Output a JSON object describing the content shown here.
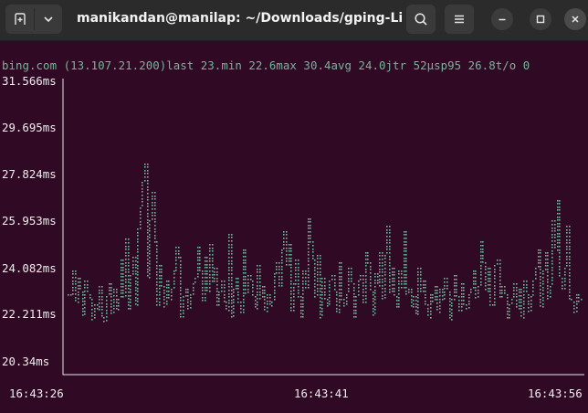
{
  "window": {
    "title": "manikandan@manilap: ~/Downloads/gping-Lin..."
  },
  "icons": {
    "new_tab": "new-tab-icon",
    "menu_dropdown": "chevron-down-icon",
    "search": "search-icon",
    "menu": "hamburger-icon",
    "minimize": "minimize-icon",
    "maximize": "maximize-icon",
    "close": "close-icon"
  },
  "colors": {
    "terminal_bg": "#300a24",
    "plot_line": "#74b49a",
    "text": "#ededed"
  },
  "status_line": "bing.com (13.107.21.200)last 23.min 22.6max 30.4avg 24.0jtr 52μsp95 26.8t/o 0",
  "chart_data": {
    "type": "line",
    "title": "",
    "xlabel": "",
    "ylabel": "",
    "ylim": [
      20.34,
      31.566
    ],
    "y_ticks": [
      "31.566ms",
      "29.695ms",
      "27.824ms",
      "25.953ms",
      "24.082ms",
      "22.211ms",
      "20.34ms"
    ],
    "x_ticks": [
      "16:43:26",
      "16:43:41",
      "16:43:56"
    ],
    "xlim": [
      "16:43:26",
      "16:43:56"
    ],
    "grid": false,
    "legend": "none",
    "series": [
      {
        "host": "bing.com",
        "values": [
          23.4,
          23.3,
          24.3,
          23.1,
          24.0,
          23.5,
          22.6,
          23.9,
          23.4,
          23.2,
          22.4,
          23.0,
          22.8,
          23.7,
          22.5,
          22.3,
          23.3,
          23.8,
          22.6,
          23.6,
          22.8,
          23.2,
          24.7,
          23.3,
          25.5,
          22.8,
          24.1,
          24.8,
          23.0,
          25.9,
          26.7,
          27.7,
          28.4,
          24.0,
          26.2,
          27.3,
          25.4,
          22.9,
          24.5,
          23.7,
          22.9,
          23.9,
          23.2,
          23.6,
          24.3,
          25.2,
          24.8,
          22.5,
          23.3,
          23.6,
          22.8,
          23.4,
          23.8,
          24.0,
          25.2,
          24.3,
          23.1,
          24.8,
          23.5,
          25.3,
          23.8,
          24.4,
          22.9,
          23.5,
          23.9,
          23.1,
          22.8,
          25.7,
          22.5,
          23.6,
          24.0,
          23.1,
          22.7,
          25.1,
          23.4,
          24.1,
          23.9,
          23.3,
          22.8,
          24.5,
          23.2,
          23.7,
          22.7,
          23.4,
          22.9,
          23.1,
          24.2,
          24.6,
          23.6,
          25.1,
          25.8,
          24.5,
          25.3,
          22.7,
          23.8,
          24.7,
          23.3,
          22.5,
          24.3,
          23.6,
          26.3,
          25.4,
          24.7,
          23.3,
          24.9,
          22.5,
          24.0,
          23.2,
          22.9,
          23.9,
          24.1,
          23.5,
          22.7,
          24.6,
          23.2,
          22.9,
          23.4,
          24.4,
          23.8,
          22.5,
          23.3,
          23.9,
          24.1,
          23.0,
          25.0,
          24.6,
          23.5,
          22.6,
          24.2,
          23.7,
          25.0,
          23.2,
          24.9,
          26.0,
          23.4,
          24.4,
          23.3,
          22.8,
          24.3,
          23.6,
          25.8,
          23.4,
          23.6,
          22.9,
          23.3,
          22.6,
          24.4,
          23.4,
          23.9,
          23.0,
          22.5,
          23.4,
          23.1,
          23.7,
          22.7,
          23.6,
          23.2,
          24.0,
          23.5,
          22.4,
          23.2,
          24.1,
          23.3,
          22.7,
          23.8,
          23.0,
          22.8,
          23.4,
          23.6,
          24.3,
          23.2,
          23.7,
          25.4,
          24.6,
          23.5,
          24.4,
          23.0,
          22.9,
          24.5,
          24.7,
          23.3,
          23.7,
          23.4,
          22.4,
          23.0,
          23.2,
          23.8,
          22.8,
          23.6,
          22.5,
          23.9,
          23.4,
          22.7,
          23.3,
          23.9,
          24.4,
          25.1,
          22.9,
          24.3,
          25.0,
          23.2,
          23.7,
          26.2,
          25.1,
          27.0,
          24.0,
          23.6,
          24.4,
          26.0,
          23.2,
          23.1,
          22.7,
          23.4,
          23.1,
          23.2
        ]
      }
    ]
  }
}
